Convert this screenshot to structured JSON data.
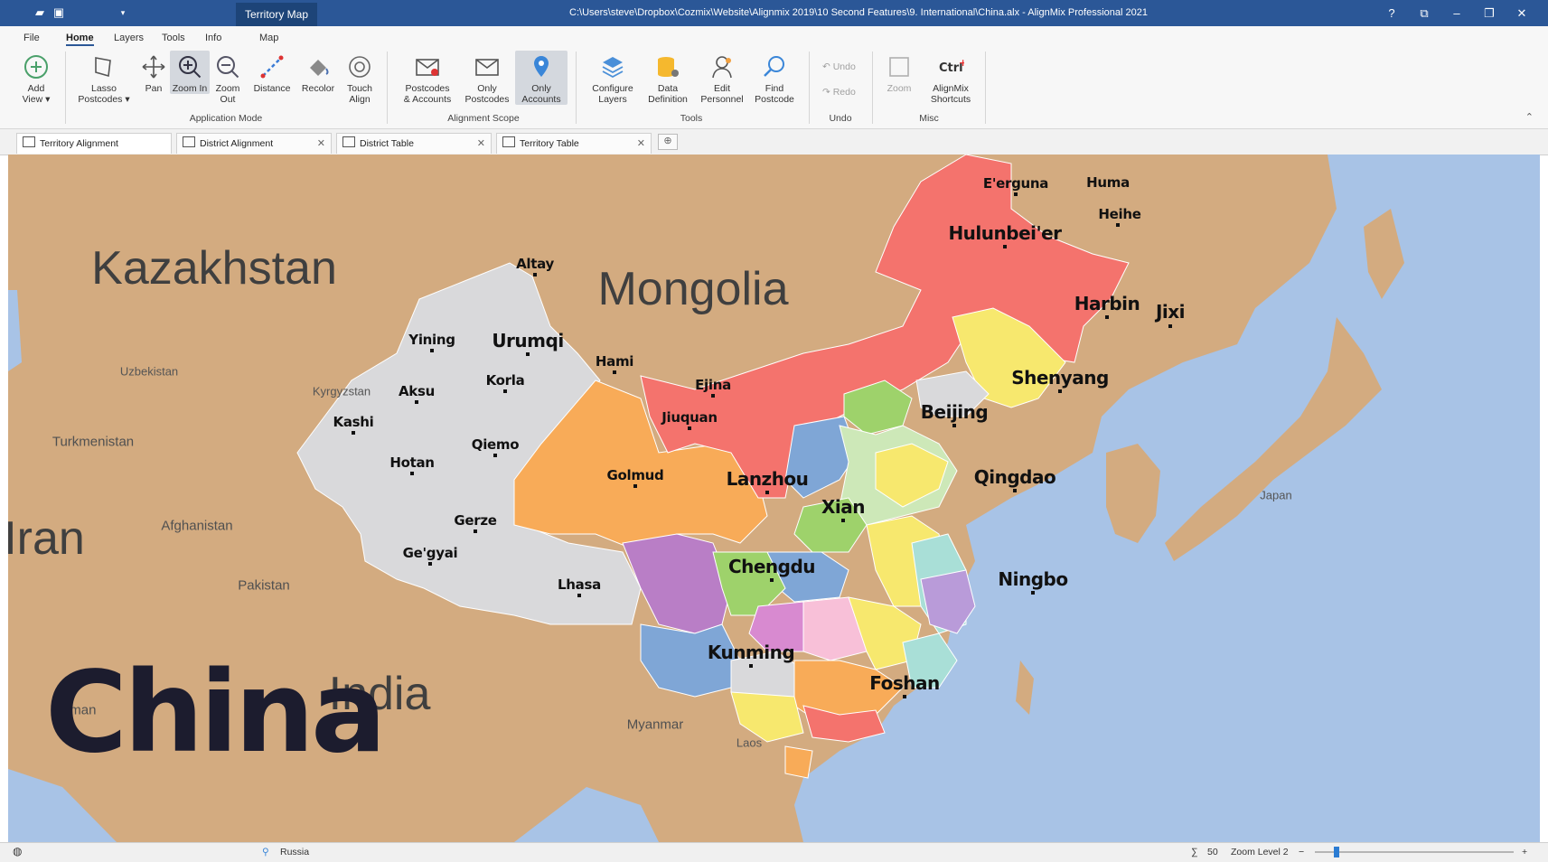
{
  "titlebar": {
    "context_tab": "Territory Map",
    "title": "C:\\Users\\steve\\Dropbox\\Cozmix\\Website\\Alignmix 2019\\10 Second Features\\9. International\\China.alx - AlignMix Professional 2021",
    "help": "?",
    "minimize": "–",
    "close": "✕"
  },
  "ribbon": {
    "tabs": [
      "File",
      "Home",
      "Layers",
      "Tools",
      "Info",
      "Map"
    ],
    "active_tab": "Home",
    "buttons": {
      "add_view": "Add View ▾",
      "lasso": "Lasso Postcodes ▾",
      "pan": "Pan",
      "zoom_in": "Zoom In",
      "zoom_out": "Zoom Out",
      "distance": "Distance",
      "recolor": "Recolor",
      "touch_align": "Touch Align",
      "postcodes_accounts": "Postcodes & Accounts",
      "only_postcodes": "Only Postcodes",
      "only_accounts": "Only Accounts",
      "configure_layers": "Configure Layers",
      "data_definition": "Data Definition",
      "edit_personnel": "Edit Personnel",
      "find_postcode": "Find Postcode",
      "undo": "Undo",
      "redo": "Redo",
      "zoom": "Zoom",
      "shortcuts": "AlignMix Shortcuts"
    },
    "groups": {
      "application_mode": "Application Mode",
      "alignment_scope": "Alignment Scope",
      "tools": "Tools",
      "undo": "Undo",
      "misc": "Misc"
    }
  },
  "doc_tabs": [
    {
      "label": "Territory Alignment"
    },
    {
      "label": "District Alignment"
    },
    {
      "label": "District Table"
    },
    {
      "label": "Territory Table"
    }
  ],
  "map": {
    "china_label": "China",
    "countries": {
      "kazakhstan": "Kazakhstan",
      "mongolia": "Mongolia",
      "iran": "Iran",
      "india": "India",
      "uzbekistan": "Uzbekistan",
      "kyrgyzstan": "Kyrgyzstan",
      "turkmenistan": "Turkmenistan",
      "afghanistan": "Afghanistan",
      "pakistan": "Pakistan",
      "oman": "Oman",
      "myanmar": "Myanmar",
      "laos": "Laos",
      "japan": "Japan"
    },
    "cities": {
      "erguna": "E'erguna",
      "huma": "Huma",
      "heihe": "Heihe",
      "hulunbeier": "Hulunbei'er",
      "harbin": "Harbin",
      "jixi": "Jixi",
      "shenyang": "Shenyang",
      "beijing": "Beijing",
      "qingdao": "Qingdao",
      "xian": "Xian",
      "lanzhou": "Lanzhou",
      "ejina": "Ejina",
      "jiuquan": "Jiuquan",
      "golmud": "Golmud",
      "chengdu": "Chengdu",
      "ningbo": "Ningbo",
      "kunming": "Kunming",
      "foshan": "Foshan",
      "altay": "Altay",
      "urumqi": "Urumqi",
      "yining": "Yining",
      "hami": "Hami",
      "korla": "Korla",
      "aksu": "Aksu",
      "kashi": "Kashi",
      "qiemo": "Qiemo",
      "hotan": "Hotan",
      "gerze": "Gerze",
      "gegyai": "Ge'gyai",
      "lhasa": "Lhasa"
    }
  },
  "statusbar": {
    "location": "Russia",
    "sum_icon": "∑",
    "count": "50",
    "zoom_level": "Zoom Level 2",
    "zoom_minus": "−",
    "zoom_plus": "+",
    "zoom_fraction": 0.1
  },
  "colors": {
    "titlebar": "#2b5797",
    "ocean": "#a8c3e6",
    "land": "#d3ab80",
    "northeast_region": "#f4736d",
    "west_region": "#d9d9db",
    "central_region": "#f8ab58",
    "southwest_region": "#b97ec6",
    "yunnan_region": "#7fa6d6",
    "manchuria_region": "#f7e86e"
  }
}
